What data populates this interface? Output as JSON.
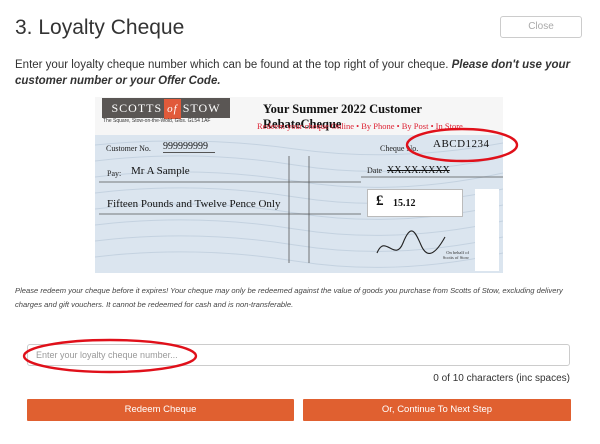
{
  "header": {
    "title": "3. Loyalty Cheque",
    "close_label": "Close"
  },
  "intro": {
    "text": "Enter your loyalty cheque number which can be found at the top right of your cheque. ",
    "emphasis": "Please don't use your customer number or your Offer Code."
  },
  "cheque": {
    "logo_left": "SCOTTS",
    "logo_mid": "of",
    "logo_right": "STOW",
    "logo_address": "The Square, Stow-on-the-Wold, Glos. GL54 1AF",
    "heading": "Your Summer 2022 Customer RebateCheque",
    "subheading": "Redeem your cheque Online • By Phone • By Post • In Store",
    "customer_no_label": "Customer No.",
    "customer_no_value": "999999999",
    "cheque_no_label": "Cheque No.",
    "cheque_no_value": "ABCD1234",
    "pay_label": "Pay:",
    "pay_value": "Mr A Sample",
    "date_label": "Date",
    "date_value": "XX.XX.XXXX",
    "amount_words": "Fifteen Pounds and Twelve Pence Only",
    "currency_symbol": "£",
    "amount_value": "15.12",
    "behalf_text": "On behalf of Scotts of Stow"
  },
  "disclaimer": "Please redeem your cheque before it expires! Your cheque may only be redeemed against the value of goods you purchase from Scotts of Stow, excluding delivery charges and gift vouchers. It cannot be redeemed for cash and is non-transferable.",
  "form": {
    "placeholder": "Enter your loyalty cheque number...",
    "counter": "0 of 10 characters (inc spaces)",
    "redeem_label": "Redeem Cheque",
    "next_label": "Or, Continue To Next Step"
  },
  "colors": {
    "accent": "#e06030",
    "highlight_ring": "#e0101a",
    "cheque_bg": "#dbe5ef"
  }
}
